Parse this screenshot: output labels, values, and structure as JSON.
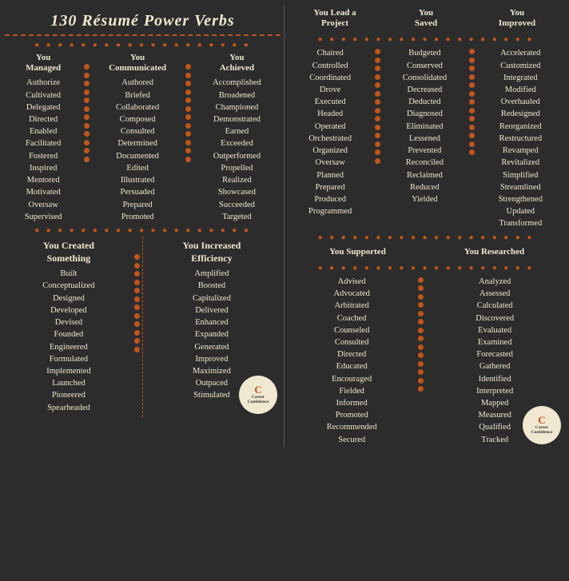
{
  "title": "130 Résumé Power Verbs",
  "left": {
    "managed": {
      "header": [
        "You",
        "Managed"
      ],
      "words": [
        "Authorize",
        "Cultivated",
        "Delegated",
        "Directed",
        "Enabled",
        "Facilitated",
        "Fostered",
        "Inspired",
        "Mentored",
        "Motivated",
        "Oversaw",
        "Supervised"
      ]
    },
    "communicated": {
      "header": [
        "You",
        "Communicated"
      ],
      "words": [
        "Authored",
        "Briefed",
        "Collaborated",
        "Composed",
        "Consulted",
        "Determined",
        "Documented",
        "Edited",
        "Illustrated",
        "Persuaded",
        "Prepared",
        "Promoted"
      ]
    },
    "achieved": {
      "header": [
        "You",
        "Achieved"
      ],
      "words": [
        "Accomplished",
        "Broadened",
        "Championed",
        "Demonstrated",
        "Earned",
        "Exceeded",
        "Outperformed",
        "Propelled",
        "Realized",
        "Showcased",
        "Succeeded",
        "Targeted"
      ]
    },
    "created": {
      "header": [
        "You Created",
        "Something"
      ],
      "words": [
        "Built",
        "Conceptualized",
        "Designed",
        "Developed",
        "Devised",
        "Founded",
        "Engineered",
        "Formulated",
        "Implemented",
        "Launched",
        "Pioneered",
        "Spearheaded"
      ]
    },
    "increased": {
      "header": [
        "You Increased",
        "Efficiency"
      ],
      "words": [
        "Amplified",
        "Boosted",
        "Capitalized",
        "Delivered",
        "Enhanced",
        "Expanded",
        "Generated",
        "Improved",
        "Maximized",
        "Outpaced",
        "Stimulated"
      ]
    }
  },
  "right": {
    "lead": {
      "header": [
        "You Lead a",
        "Project"
      ],
      "words": [
        "Chaired",
        "Controlled",
        "Coordinated",
        "Drove",
        "Executed",
        "Headed",
        "Operated",
        "Orchestrated",
        "Organized",
        "Oversaw",
        "Planned",
        "Prepared",
        "Produced",
        "Programmed"
      ]
    },
    "saved": {
      "header": [
        "You",
        "Saved"
      ],
      "words": [
        "Budgeted",
        "Conserved",
        "Consolidated",
        "Decreased",
        "Deducted",
        "Diagnosed",
        "Eliminated",
        "Lessened",
        "Prevented",
        "Reconciled",
        "Reclaimed",
        "Reduced",
        "Yielded"
      ]
    },
    "improved": {
      "header": [
        "You",
        "Improved"
      ],
      "words": [
        "Accelerated",
        "Customized",
        "Integrated",
        "Modified",
        "Overhauled",
        "Redesigned",
        "Reorganized",
        "Restructured",
        "Revamped",
        "Revitalized",
        "Simplified",
        "Streamlined",
        "Strengthened",
        "Updated",
        "Transformed"
      ]
    },
    "supported": {
      "header": [
        "You Supported"
      ],
      "words": [
        "Advised",
        "Advocated",
        "Arbitrated",
        "Coached",
        "Counseled",
        "Consulted",
        "Directed",
        "Educated",
        "Encouraged",
        "Fielded",
        "Informed",
        "Promoted",
        "Recommended",
        "Secured"
      ]
    },
    "researched": {
      "header": [
        "You Researched"
      ],
      "words": [
        "Analyzed",
        "Assessed",
        "Calculated",
        "Discovered",
        "Evaluated",
        "Examined",
        "Forecasted",
        "Gathered",
        "Identified",
        "Interpreted",
        "Mapped",
        "Measured",
        "Qualified",
        "Tracked"
      ]
    }
  },
  "dots": "● ● ● ● ● ● ● ● ● ● ● ● ● ● ● ● ● ● ● ● ●",
  "career_label": "Career\nConfidence"
}
